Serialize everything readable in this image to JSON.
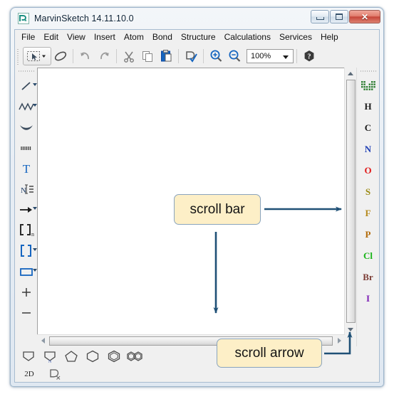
{
  "window": {
    "title": "MarvinSketch 14.11.10.0",
    "app_icon": "marvinsketch-icon",
    "controls": {
      "minimize": "minimize-button",
      "maximize": "maximize-button",
      "close": "✕"
    }
  },
  "menubar": {
    "items": [
      {
        "label": "File"
      },
      {
        "label": "Edit"
      },
      {
        "label": "View"
      },
      {
        "label": "Insert"
      },
      {
        "label": "Atom"
      },
      {
        "label": "Bond"
      },
      {
        "label": "Structure"
      },
      {
        "label": "Calculations"
      },
      {
        "label": "Services"
      },
      {
        "label": "Help"
      }
    ]
  },
  "toolbar": {
    "items": [
      {
        "name": "selection-tool",
        "icon": "selection-arrow-icon"
      },
      {
        "name": "eraser-tool",
        "icon": "eraser-icon"
      },
      {
        "name": "undo-button",
        "icon": "undo-icon"
      },
      {
        "name": "redo-button",
        "icon": "redo-icon"
      },
      {
        "name": "cut-button",
        "icon": "scissors-icon"
      },
      {
        "name": "copy-button",
        "icon": "copy-icon"
      },
      {
        "name": "paste-button",
        "icon": "paste-icon"
      },
      {
        "name": "structure-check-button",
        "icon": "structure-check-icon"
      },
      {
        "name": "zoom-in-button",
        "icon": "magnifier-plus-icon"
      },
      {
        "name": "zoom-out-button",
        "icon": "magnifier-minus-icon"
      },
      {
        "name": "help-button",
        "icon": "question-mark-icon"
      }
    ],
    "zoom_value": "100%"
  },
  "left_tools": [
    {
      "name": "single-bond-tool",
      "icon": "single-bond-icon",
      "dropdown": true
    },
    {
      "name": "chain-tool",
      "icon": "zigzag-chain-icon",
      "dropdown": true
    },
    {
      "name": "arc-tool",
      "icon": "arc-icon",
      "dropdown": false
    },
    {
      "name": "graphic-hash-tool",
      "icon": "hash-lines-icon",
      "dropdown": false
    },
    {
      "name": "text-tool",
      "icon": "text-T-icon",
      "label": "T",
      "dropdown": false
    },
    {
      "name": "atom-label-tool",
      "icon": "atom-label-icon",
      "dropdown": false
    },
    {
      "name": "reaction-arrow-tool",
      "icon": "reaction-arrow-icon",
      "dropdown": true
    },
    {
      "name": "repeating-unit-tool",
      "icon": "brackets-n-icon",
      "dropdown": false
    },
    {
      "name": "bracket-tool",
      "icon": "brackets-icon",
      "dropdown": true
    },
    {
      "name": "rectangle-tool",
      "icon": "rectangle-icon",
      "dropdown": true
    },
    {
      "name": "charge-plus-tool",
      "icon": "plus-icon",
      "dropdown": false
    },
    {
      "name": "charge-minus-tool",
      "icon": "minus-icon",
      "dropdown": false
    }
  ],
  "element_palette": [
    {
      "name": "periodic-table-button",
      "icon": "periodic-table-icon",
      "label": "",
      "color": "#2e7d32"
    },
    {
      "name": "element-H",
      "label": "H",
      "color": "#1a1a1a"
    },
    {
      "name": "element-C",
      "label": "C",
      "color": "#1a1a1a"
    },
    {
      "name": "element-N",
      "label": "N",
      "color": "#1f3fb5"
    },
    {
      "name": "element-O",
      "label": "O",
      "color": "#e01b1b"
    },
    {
      "name": "element-S",
      "label": "S",
      "color": "#9b8a14"
    },
    {
      "name": "element-F",
      "label": "F",
      "color": "#b5891c"
    },
    {
      "name": "element-P",
      "label": "P",
      "color": "#b26a08"
    },
    {
      "name": "element-Cl",
      "label": "Cl",
      "color": "#18b418"
    },
    {
      "name": "element-Br",
      "label": "Br",
      "color": "#7a3a33"
    },
    {
      "name": "element-I",
      "label": "I",
      "color": "#7d1fb5"
    }
  ],
  "ring_templates": [
    {
      "name": "template-cyclopentane-flat",
      "icon": "ring-pentagon-flat-icon"
    },
    {
      "name": "template-pyrrole",
      "icon": "ring-pyrrole-icon",
      "heteroatom": "N"
    },
    {
      "name": "template-cyclopentane",
      "icon": "ring-pentagon-icon"
    },
    {
      "name": "template-cyclohexane",
      "icon": "ring-hexagon-icon"
    },
    {
      "name": "template-benzene",
      "icon": "ring-benzene-icon"
    },
    {
      "name": "template-naphthalene",
      "icon": "ring-naphthalene-icon"
    }
  ],
  "status_bar": {
    "dimension_label": "2D",
    "clean_button_icon": "clean-structure-icon"
  },
  "scrollbars": {
    "vertical": {
      "up_arrow": "scroll-up-arrow",
      "down_arrow": "scroll-down-arrow",
      "thumb": "vertical-scroll-thumb"
    },
    "horizontal": {
      "left_arrow": "scroll-left-arrow",
      "right_arrow": "scroll-right-arrow",
      "thumb": "horizontal-scroll-thumb"
    }
  },
  "annotations": {
    "scroll_bar_label": "scroll bar",
    "scroll_arrow_label": "scroll arrow",
    "arrow_color": "#1f5076"
  }
}
